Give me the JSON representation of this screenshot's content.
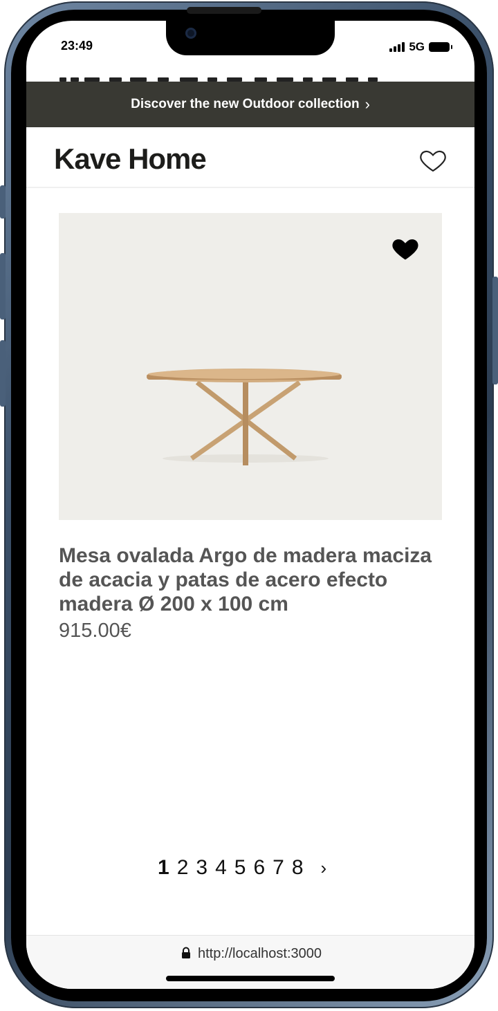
{
  "status_bar": {
    "time": "23:49",
    "network": "5G"
  },
  "promo": {
    "text": "Discover the new Outdoor collection",
    "chevron": "›"
  },
  "header": {
    "logo": "Kave Home",
    "wishlist_icon": "heart-outline-icon"
  },
  "product": {
    "title": "Mesa ovalada Argo de madera maciza de acacia y patas de acero efecto madera Ø 200 x 100 cm",
    "price": "915.00€",
    "favorite_icon": "heart-filled-icon",
    "favorited": true,
    "image": "oval wooden table"
  },
  "pagination": {
    "pages": [
      "1",
      "2",
      "3",
      "4",
      "5",
      "6",
      "7",
      "8"
    ],
    "current": "1",
    "next_symbol": "›"
  },
  "browser": {
    "url": "http://localhost:3000",
    "lock_icon": "lock-icon"
  },
  "colors": {
    "promo_bg": "#393933",
    "image_bg": "#efeeea",
    "text_gray": "#555555",
    "frame": "#3a4f68"
  }
}
